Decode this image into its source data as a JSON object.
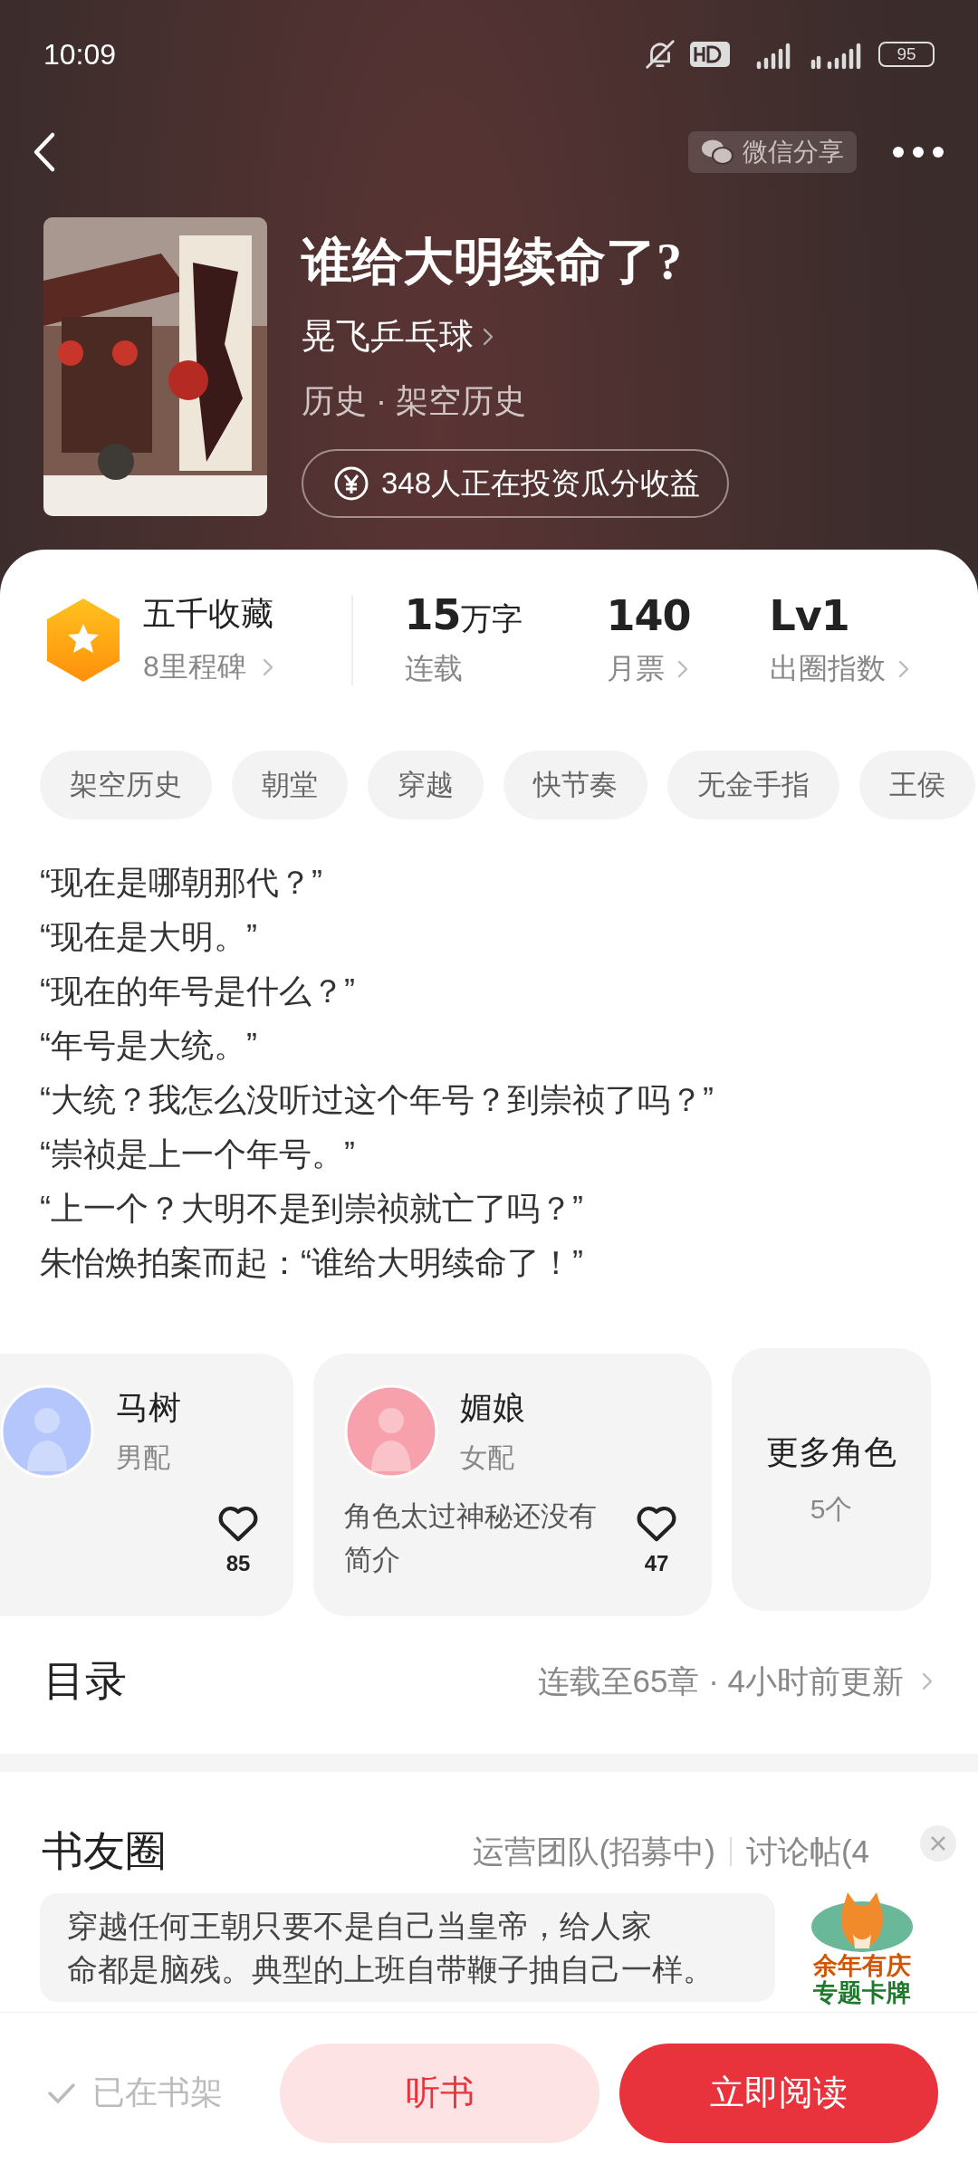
{
  "status_bar": {
    "time": "10:09",
    "battery": "95"
  },
  "nav": {
    "share_label": "微信分享"
  },
  "book": {
    "title": "谁给大明续命了?",
    "author": "晃飞乒乓球",
    "genre": "历史 · 架空历史",
    "invest": "348人正在投资瓜分收益"
  },
  "collect": {
    "title": "五千收藏",
    "subtitle": "8里程碑"
  },
  "stats": [
    {
      "value": "15",
      "unit": "万字",
      "label": "连载",
      "link": false
    },
    {
      "value": "140",
      "label": "月票",
      "link": true
    },
    {
      "value": "Lv1",
      "label": "出圈指数",
      "link": true
    }
  ],
  "tags": [
    "架空历史",
    "朝堂",
    "穿越",
    "快节奏",
    "无金手指",
    "王侯"
  ],
  "synopsis": [
    "“现在是哪朝那代？”",
    "“现在是大明。”",
    "“现在的年号是什么？”",
    "“年号是大统。”",
    "“大统？我怎么没听过这个年号？到崇祯了吗？”",
    "“崇祯是上一个年号。”",
    "“上一个？大明不是到崇祯就亡了吗？”",
    "朱怡焕拍案而起：“谁给大明续命了！”"
  ],
  "characters": [
    {
      "name": "马树",
      "role": "男配",
      "likes": "85",
      "color": "#b4c6fb"
    },
    {
      "name": "媚娘",
      "role": "女配",
      "description": "角色太过神秘还没有简介",
      "likes": "47",
      "color": "#f7a1ac"
    }
  ],
  "more_characters": {
    "label": "更多角色",
    "count": "5个"
  },
  "catalog": {
    "title": "目录",
    "status": "连载至65章 · 4小时前更新"
  },
  "community": {
    "title": "书友圈",
    "links": [
      "运营团队(招募中)",
      "讨论帖(4"
    ],
    "comment": [
      "穿越任何王朝只要不是自己当皇帝，给人家",
      "命都是脑残。典型的上班自带鞭子抽自己一样。"
    ]
  },
  "promo": {
    "lines": [
      "余年有庆",
      "专题卡牌"
    ]
  },
  "bottom_bar": {
    "shelf": {
      "label": "已在书架",
      "checked": true
    },
    "listen": "听书",
    "read": "立即阅读"
  }
}
